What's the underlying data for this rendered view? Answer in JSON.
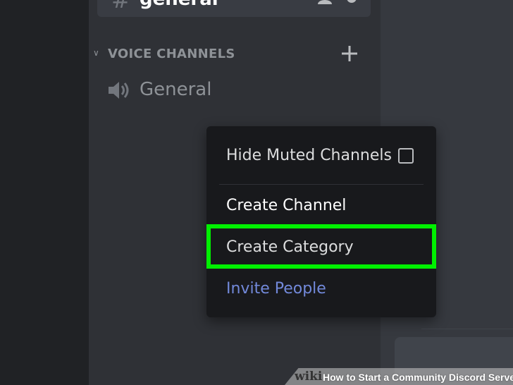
{
  "channels": {
    "text_channel": {
      "name": "general",
      "icon": "hash-icon"
    },
    "voice_category": {
      "label": "VOICE CHANNELS",
      "add_icon": "plus-icon",
      "collapse_icon": "chevron-down-icon"
    },
    "voice_channels": [
      {
        "name": "General",
        "icon": "speaker-icon"
      }
    ]
  },
  "context_menu": {
    "items": [
      {
        "label": "Hide Muted Channels",
        "type": "checkbox",
        "checked": false
      },
      {
        "label": "Create Channel"
      },
      {
        "label": "Create Category",
        "highlighted": true
      },
      {
        "label": "Invite People",
        "color": "#7289da"
      }
    ]
  },
  "watermark": {
    "brand": "wiki",
    "title_bold": "How",
    "title_rest": " to Start a Community Discord Server"
  },
  "colors": {
    "highlight": "#00f000",
    "accent": "#7289da",
    "background": "#2f3136"
  }
}
